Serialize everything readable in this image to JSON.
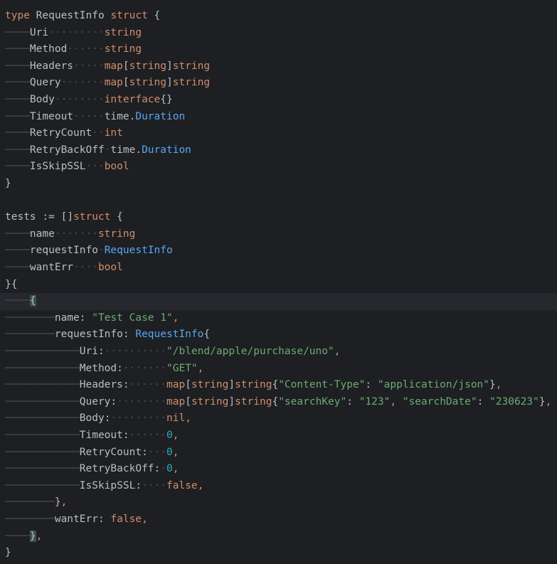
{
  "editor": {
    "lines": [
      [
        [
          "kw",
          "type"
        ],
        [
          "plain",
          " RequestInfo "
        ],
        [
          "kw",
          "struct"
        ],
        [
          "punc",
          " {"
        ]
      ],
      [
        [
          "ws",
          "────"
        ],
        [
          "field",
          "Uri"
        ],
        [
          "ws",
          "·········"
        ],
        [
          "kw",
          "string"
        ]
      ],
      [
        [
          "ws",
          "────"
        ],
        [
          "field",
          "Method"
        ],
        [
          "ws",
          "······"
        ],
        [
          "kw",
          "string"
        ]
      ],
      [
        [
          "ws",
          "────"
        ],
        [
          "field",
          "Headers"
        ],
        [
          "ws",
          "·····"
        ],
        [
          "kw",
          "map"
        ],
        [
          "punc",
          "["
        ],
        [
          "kw",
          "string"
        ],
        [
          "punc",
          "]"
        ],
        [
          "kw",
          "string"
        ]
      ],
      [
        [
          "ws",
          "────"
        ],
        [
          "field",
          "Query"
        ],
        [
          "ws",
          "·······"
        ],
        [
          "kw",
          "map"
        ],
        [
          "punc",
          "["
        ],
        [
          "kw",
          "string"
        ],
        [
          "punc",
          "]"
        ],
        [
          "kw",
          "string"
        ]
      ],
      [
        [
          "ws",
          "────"
        ],
        [
          "field",
          "Body"
        ],
        [
          "ws",
          "········"
        ],
        [
          "kw",
          "interface"
        ],
        [
          "punc",
          "{}"
        ]
      ],
      [
        [
          "ws",
          "────"
        ],
        [
          "field",
          "Timeout"
        ],
        [
          "ws",
          "·····"
        ],
        [
          "plain",
          "time."
        ],
        [
          "typ",
          "Duration"
        ]
      ],
      [
        [
          "ws",
          "────"
        ],
        [
          "field",
          "RetryCount"
        ],
        [
          "ws",
          "··"
        ],
        [
          "kw",
          "int"
        ]
      ],
      [
        [
          "ws",
          "────"
        ],
        [
          "field",
          "RetryBackOff"
        ],
        [
          "ws",
          "·"
        ],
        [
          "plain",
          "time."
        ],
        [
          "typ",
          "Duration"
        ]
      ],
      [
        [
          "ws",
          "────"
        ],
        [
          "field",
          "IsSkipSSL"
        ],
        [
          "ws",
          "···"
        ],
        [
          "kw",
          "bool"
        ]
      ],
      [
        [
          "punc",
          "}"
        ]
      ],
      [],
      [
        [
          "plain",
          "tests "
        ],
        [
          "punc",
          ":="
        ],
        [
          "plain",
          " []"
        ],
        [
          "kw",
          "struct"
        ],
        [
          "punc",
          " {"
        ]
      ],
      [
        [
          "ws",
          "────"
        ],
        [
          "field",
          "name"
        ],
        [
          "ws",
          "·······"
        ],
        [
          "kw",
          "string"
        ]
      ],
      [
        [
          "ws",
          "────"
        ],
        [
          "field",
          "requestInfo"
        ],
        [
          "ws",
          "·"
        ],
        [
          "typ",
          "RequestInfo"
        ]
      ],
      [
        [
          "ws",
          "────"
        ],
        [
          "field",
          "wantErr"
        ],
        [
          "ws",
          "····"
        ],
        [
          "kw",
          "bool"
        ]
      ],
      [
        [
          "punc",
          "}{"
        ]
      ],
      [
        [
          "ws",
          "────"
        ],
        [
          "bracket-hl",
          "{"
        ]
      ],
      [
        [
          "ws",
          "────────"
        ],
        [
          "field",
          "name"
        ],
        [
          "punc",
          ": "
        ],
        [
          "str",
          "\"Test Case 1\""
        ],
        [
          "kw",
          ","
        ]
      ],
      [
        [
          "ws",
          "────────"
        ],
        [
          "field",
          "requestInfo"
        ],
        [
          "punc",
          ": "
        ],
        [
          "typ",
          "RequestInfo"
        ],
        [
          "punc",
          "{"
        ]
      ],
      [
        [
          "ws",
          "────────────"
        ],
        [
          "field",
          "Uri"
        ],
        [
          "punc",
          ":"
        ],
        [
          "ws",
          "··········"
        ],
        [
          "str",
          "\"/blend/apple/purchase/uno\""
        ],
        [
          "kw",
          ","
        ]
      ],
      [
        [
          "ws",
          "────────────"
        ],
        [
          "field",
          "Method"
        ],
        [
          "punc",
          ":"
        ],
        [
          "ws",
          "·······"
        ],
        [
          "str",
          "\"GET\""
        ],
        [
          "kw",
          ","
        ]
      ],
      [
        [
          "ws",
          "────────────"
        ],
        [
          "field",
          "Headers"
        ],
        [
          "punc",
          ":"
        ],
        [
          "ws",
          "······"
        ],
        [
          "kw",
          "map"
        ],
        [
          "punc",
          "["
        ],
        [
          "kw",
          "string"
        ],
        [
          "punc",
          "]"
        ],
        [
          "kw",
          "string"
        ],
        [
          "punc",
          "{"
        ],
        [
          "str",
          "\"Content-Type\""
        ],
        [
          "punc",
          ": "
        ],
        [
          "str",
          "\"application/json\""
        ],
        [
          "punc",
          "}"
        ],
        [
          "kw",
          ","
        ]
      ],
      [
        [
          "ws",
          "────────────"
        ],
        [
          "field",
          "Query"
        ],
        [
          "punc",
          ":"
        ],
        [
          "ws",
          "········"
        ],
        [
          "kw",
          "map"
        ],
        [
          "punc",
          "["
        ],
        [
          "kw",
          "string"
        ],
        [
          "punc",
          "]"
        ],
        [
          "kw",
          "string"
        ],
        [
          "punc",
          "{"
        ],
        [
          "str",
          "\"searchKey\""
        ],
        [
          "punc",
          ": "
        ],
        [
          "str",
          "\"123\""
        ],
        [
          "kw",
          ", "
        ],
        [
          "str",
          "\"searchDate\""
        ],
        [
          "punc",
          ": "
        ],
        [
          "str",
          "\"230623\""
        ],
        [
          "punc",
          "}"
        ],
        [
          "kw",
          ","
        ]
      ],
      [
        [
          "ws",
          "────────────"
        ],
        [
          "field",
          "Body"
        ],
        [
          "punc",
          ":"
        ],
        [
          "ws",
          "·········"
        ],
        [
          "kw",
          "nil"
        ],
        [
          "kw",
          ","
        ]
      ],
      [
        [
          "ws",
          "────────────"
        ],
        [
          "field",
          "Timeout"
        ],
        [
          "punc",
          ":"
        ],
        [
          "ws",
          "······"
        ],
        [
          "num",
          "0"
        ],
        [
          "kw",
          ","
        ]
      ],
      [
        [
          "ws",
          "────────────"
        ],
        [
          "field",
          "RetryCount"
        ],
        [
          "punc",
          ":"
        ],
        [
          "ws",
          "···"
        ],
        [
          "num",
          "0"
        ],
        [
          "kw",
          ","
        ]
      ],
      [
        [
          "ws",
          "────────────"
        ],
        [
          "field",
          "RetryBackOff"
        ],
        [
          "punc",
          ":"
        ],
        [
          "ws",
          "·"
        ],
        [
          "num",
          "0"
        ],
        [
          "kw",
          ","
        ]
      ],
      [
        [
          "ws",
          "────────────"
        ],
        [
          "field",
          "IsSkipSSL"
        ],
        [
          "punc",
          ":"
        ],
        [
          "ws",
          "····"
        ],
        [
          "kw",
          "false"
        ],
        [
          "kw",
          ","
        ]
      ],
      [
        [
          "ws",
          "────────"
        ],
        [
          "punc",
          "}"
        ],
        [
          "kw",
          ","
        ]
      ],
      [
        [
          "ws",
          "────────"
        ],
        [
          "field",
          "wantErr"
        ],
        [
          "punc",
          ": "
        ],
        [
          "kw",
          "false"
        ],
        [
          "kw",
          ","
        ]
      ],
      [
        [
          "ws",
          "────"
        ],
        [
          "bracket-hl",
          "}"
        ],
        [
          "kw",
          ","
        ]
      ],
      [
        [
          "punc",
          "}"
        ]
      ]
    ],
    "current_line": 17
  },
  "colors": {
    "background": "#1e1f22",
    "keyword": "#cf8e6d",
    "string": "#6aab73",
    "number": "#2aacb8",
    "type": "#56a8f5",
    "text": "#bcbec4"
  }
}
